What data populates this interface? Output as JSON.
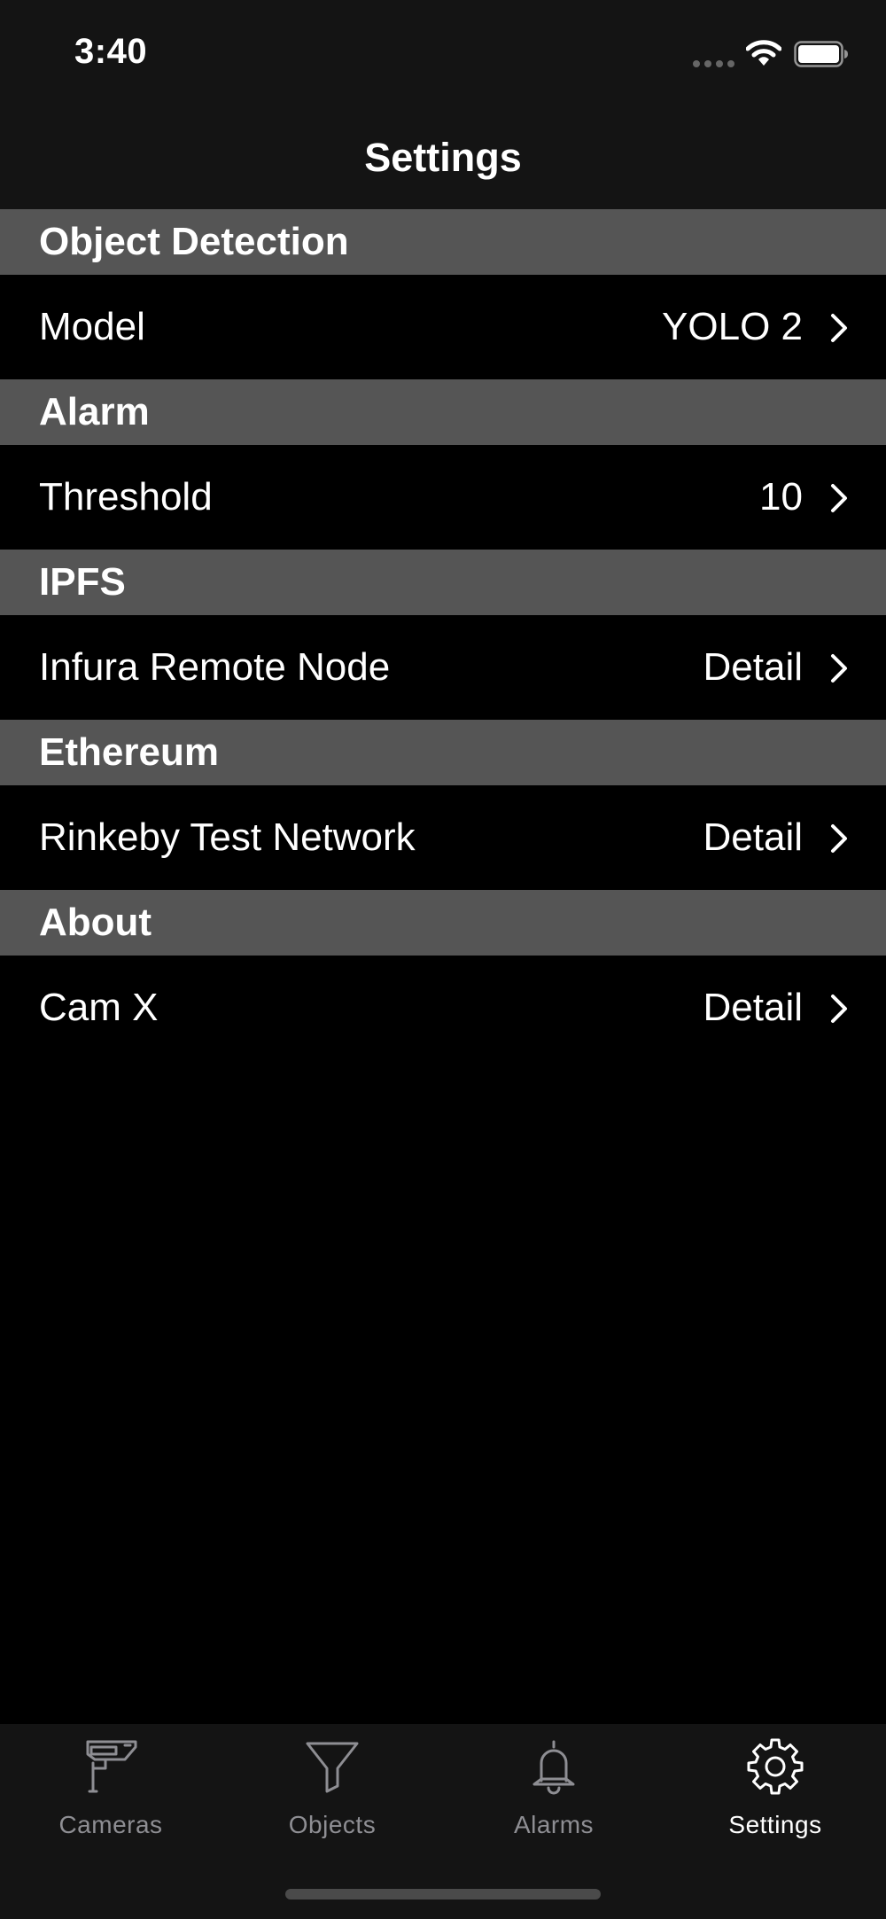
{
  "status_bar": {
    "time": "3:40"
  },
  "nav": {
    "title": "Settings"
  },
  "sections": [
    {
      "header": "Object Detection",
      "rows": [
        {
          "label": "Model",
          "value": "YOLO 2"
        }
      ]
    },
    {
      "header": "Alarm",
      "rows": [
        {
          "label": "Threshold",
          "value": "10"
        }
      ]
    },
    {
      "header": "IPFS",
      "rows": [
        {
          "label": "Infura Remote Node",
          "value": "Detail"
        }
      ]
    },
    {
      "header": "Ethereum",
      "rows": [
        {
          "label": "Rinkeby Test Network",
          "value": "Detail"
        }
      ]
    },
    {
      "header": "About",
      "rows": [
        {
          "label": "Cam X",
          "value": "Detail"
        }
      ]
    }
  ],
  "tab_bar": {
    "tabs": [
      {
        "label": "Cameras",
        "icon": "security-camera-icon",
        "active": false
      },
      {
        "label": "Objects",
        "icon": "filter-funnel-icon",
        "active": false
      },
      {
        "label": "Alarms",
        "icon": "bell-icon",
        "active": false
      },
      {
        "label": "Settings",
        "icon": "gear-icon",
        "active": true
      }
    ]
  },
  "colors": {
    "background": "#000000",
    "bars": "#141414",
    "section_header": "#555555",
    "text": "#ffffff",
    "tab_inactive": "#8e8e93",
    "tab_active": "#ffffff"
  }
}
